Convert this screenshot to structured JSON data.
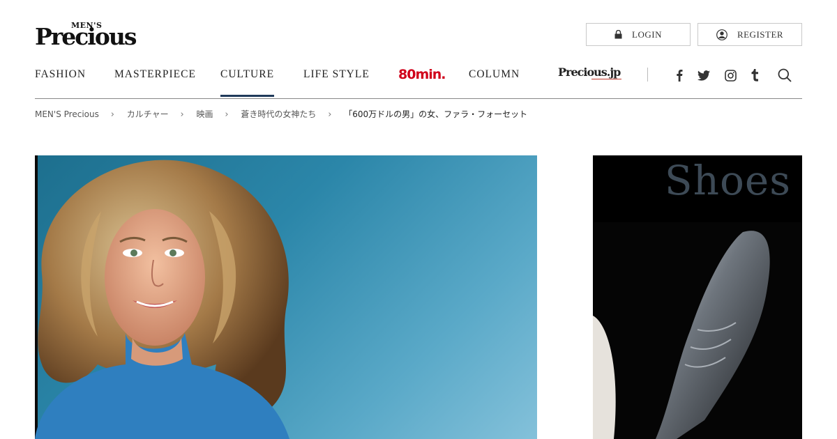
{
  "site": {
    "logo_small": "MEN'S",
    "logo_main": "Precious"
  },
  "account": {
    "login_label": "LOGIN",
    "register_label": "REGISTER"
  },
  "nav": {
    "items": [
      "FASHION",
      "MASTERPIECE",
      "CULTURE",
      "LIFE STYLE",
      "80min.",
      "COLUMN",
      "Precious.jp"
    ],
    "active_item": "CULTURE",
    "accent_color": "#1f3a5a"
  },
  "social": [
    "facebook-icon",
    "twitter-icon",
    "instagram-icon",
    "tumblr-icon",
    "search-icon"
  ],
  "breadcrumb": {
    "items": [
      "MEN'S Precious",
      "カルチャー",
      "映画",
      "蒼き時代の女神たち",
      "「600万ドルの男」の女、ファラ・フォーセット"
    ]
  },
  "hero": {
    "description_hidden": ""
  },
  "side_ad": {
    "title": "Shoes"
  }
}
